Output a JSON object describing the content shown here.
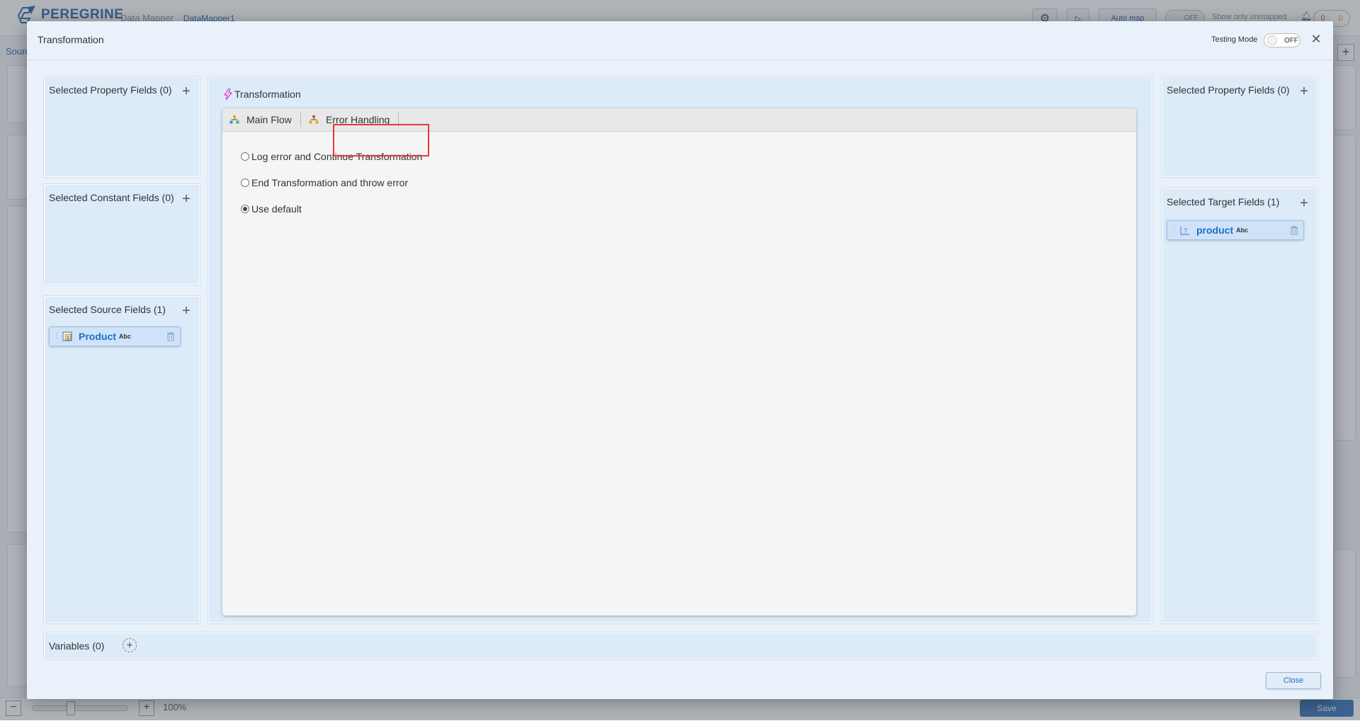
{
  "background_app": {
    "brand": "PEREGRINE",
    "app_name": "Data Mapper",
    "document_name": "DataMapper1",
    "auto_map_label": "Auto map",
    "unmapped_toggle_state": "OFF",
    "show_unmapped_label": "Show only unmapped",
    "error_count": "0",
    "warning_count": "0",
    "source_label": "Sourc",
    "zoom_value": "100%",
    "save_label": "Save"
  },
  "modal": {
    "title": "Transformation",
    "testing_mode_label": "Testing Mode",
    "testing_mode_state": "OFF",
    "left_column": {
      "property_fields": {
        "title": "Selected Property Fields (0)"
      },
      "constant_fields": {
        "title": "Selected Constant Fields (0)"
      },
      "source_fields": {
        "title": "Selected Source Fields (1)",
        "items": [
          {
            "name": "Product",
            "type": "Abc"
          }
        ]
      }
    },
    "center": {
      "title": "Transformation",
      "tabs": [
        {
          "label": "Main Flow",
          "icon": "flow-icon",
          "active": false
        },
        {
          "label": "Error Handling",
          "icon": "error-handling-icon",
          "active": true
        }
      ],
      "error_options": [
        {
          "label": "Log error and Continue Transformation",
          "checked": false
        },
        {
          "label": "End Transformation and throw error",
          "checked": false
        },
        {
          "label": "Use default",
          "checked": true
        }
      ]
    },
    "right_column": {
      "property_fields": {
        "title": "Selected Property Fields (0)"
      },
      "target_fields": {
        "title": "Selected Target Fields (1)",
        "items": [
          {
            "name": "product",
            "type": "Abc"
          }
        ]
      }
    },
    "variables": {
      "title": "Variables (0)"
    },
    "close_label": "Close"
  },
  "colors": {
    "accent": "#1d6fc8",
    "highlight": "#e53935",
    "panel_bg": "#ddebf9",
    "modal_bg": "#e9f2fb"
  }
}
